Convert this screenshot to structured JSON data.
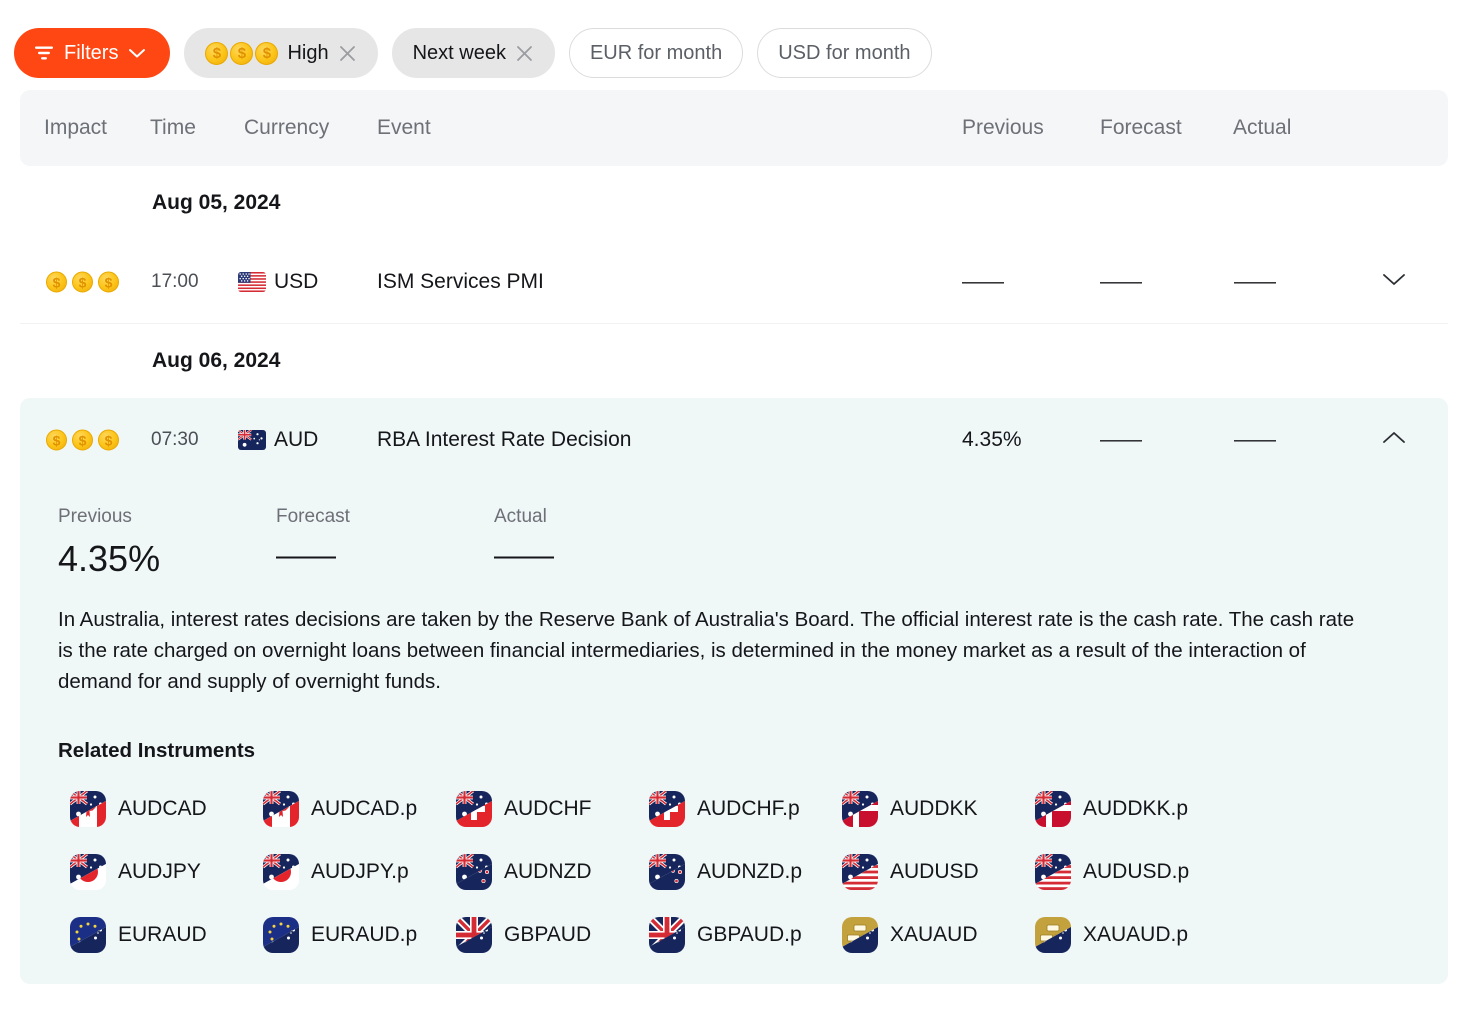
{
  "filter_bar": {
    "filters_button": {
      "label": "Filters",
      "icon": "funnel-icon",
      "chevron": "chevron-down-icon",
      "color": "#ff4713"
    },
    "chips": [
      {
        "id": "impact-high",
        "label": "High",
        "coins": 3,
        "removable": true,
        "style": "solid"
      },
      {
        "id": "next-week",
        "label": "Next week",
        "coins": 0,
        "removable": true,
        "style": "solid"
      },
      {
        "id": "eur-for-month",
        "label": "EUR for month",
        "coins": 0,
        "removable": false,
        "style": "outline"
      },
      {
        "id": "usd-for-month",
        "label": "USD for month",
        "coins": 0,
        "removable": false,
        "style": "outline"
      }
    ]
  },
  "table": {
    "headers": {
      "impact": "Impact",
      "time": "Time",
      "currency": "Currency",
      "event": "Event",
      "previous": "Previous",
      "forecast": "Forecast",
      "actual": "Actual"
    },
    "groups": [
      {
        "date": "Aug 05, 2024",
        "events": [
          {
            "impact_coins": 3,
            "time": "17:00",
            "currency": "USD",
            "flag": "us-flag-icon",
            "event": "ISM Services PMI",
            "previous": "——",
            "forecast": "——",
            "actual": "——",
            "expanded": false,
            "chevron": "chevron-down-icon"
          }
        ]
      },
      {
        "date": "Aug 06, 2024",
        "events": [
          {
            "impact_coins": 3,
            "time": "07:30",
            "currency": "AUD",
            "flag": "au-flag-icon",
            "event": "RBA Interest Rate Decision",
            "previous": "4.35%",
            "forecast": "——",
            "actual": "——",
            "expanded": true,
            "chevron": "chevron-up-icon",
            "detail": {
              "stats": [
                {
                  "label": "Previous",
                  "value": "4.35%"
                },
                {
                  "label": "Forecast",
                  "value": "——"
                },
                {
                  "label": "Actual",
                  "value": "——"
                }
              ],
              "description": "In Australia, interest rates decisions are taken by the Reserve Bank of Australia's Board. The official interest rate is the cash rate. The cash rate is the rate charged on overnight loans between financial intermediaries, is determined in the money market as a result of the interaction of demand for and supply of overnight funds.",
              "related_title": "Related Instruments",
              "related_instruments": [
                {
                  "name": "AUDCAD",
                  "top": "au",
                  "bottom": "ca"
                },
                {
                  "name": "AUDCAD.p",
                  "top": "au",
                  "bottom": "ca"
                },
                {
                  "name": "AUDCHF",
                  "top": "au",
                  "bottom": "ch"
                },
                {
                  "name": "AUDCHF.p",
                  "top": "au",
                  "bottom": "ch"
                },
                {
                  "name": "AUDDKK",
                  "top": "au",
                  "bottom": "dk"
                },
                {
                  "name": "AUDDKK.p",
                  "top": "au",
                  "bottom": "dk"
                },
                {
                  "name": "AUDJPY",
                  "top": "au",
                  "bottom": "jp"
                },
                {
                  "name": "AUDJPY.p",
                  "top": "au",
                  "bottom": "jp"
                },
                {
                  "name": "AUDNZD",
                  "top": "au",
                  "bottom": "nz"
                },
                {
                  "name": "AUDNZD.p",
                  "top": "au",
                  "bottom": "nz"
                },
                {
                  "name": "AUDUSD",
                  "top": "au",
                  "bottom": "us"
                },
                {
                  "name": "AUDUSD.p",
                  "top": "au",
                  "bottom": "us"
                },
                {
                  "name": "EURAUD",
                  "top": "eu",
                  "bottom": "au"
                },
                {
                  "name": "EURAUD.p",
                  "top": "eu",
                  "bottom": "au"
                },
                {
                  "name": "GBPAUD",
                  "top": "gb",
                  "bottom": "au"
                },
                {
                  "name": "GBPAUD.p",
                  "top": "gb",
                  "bottom": "au"
                },
                {
                  "name": "XAUAUD",
                  "top": "xau",
                  "bottom": "au"
                },
                {
                  "name": "XAUAUD.p",
                  "top": "xau",
                  "bottom": "au"
                }
              ]
            }
          }
        ]
      }
    ]
  }
}
